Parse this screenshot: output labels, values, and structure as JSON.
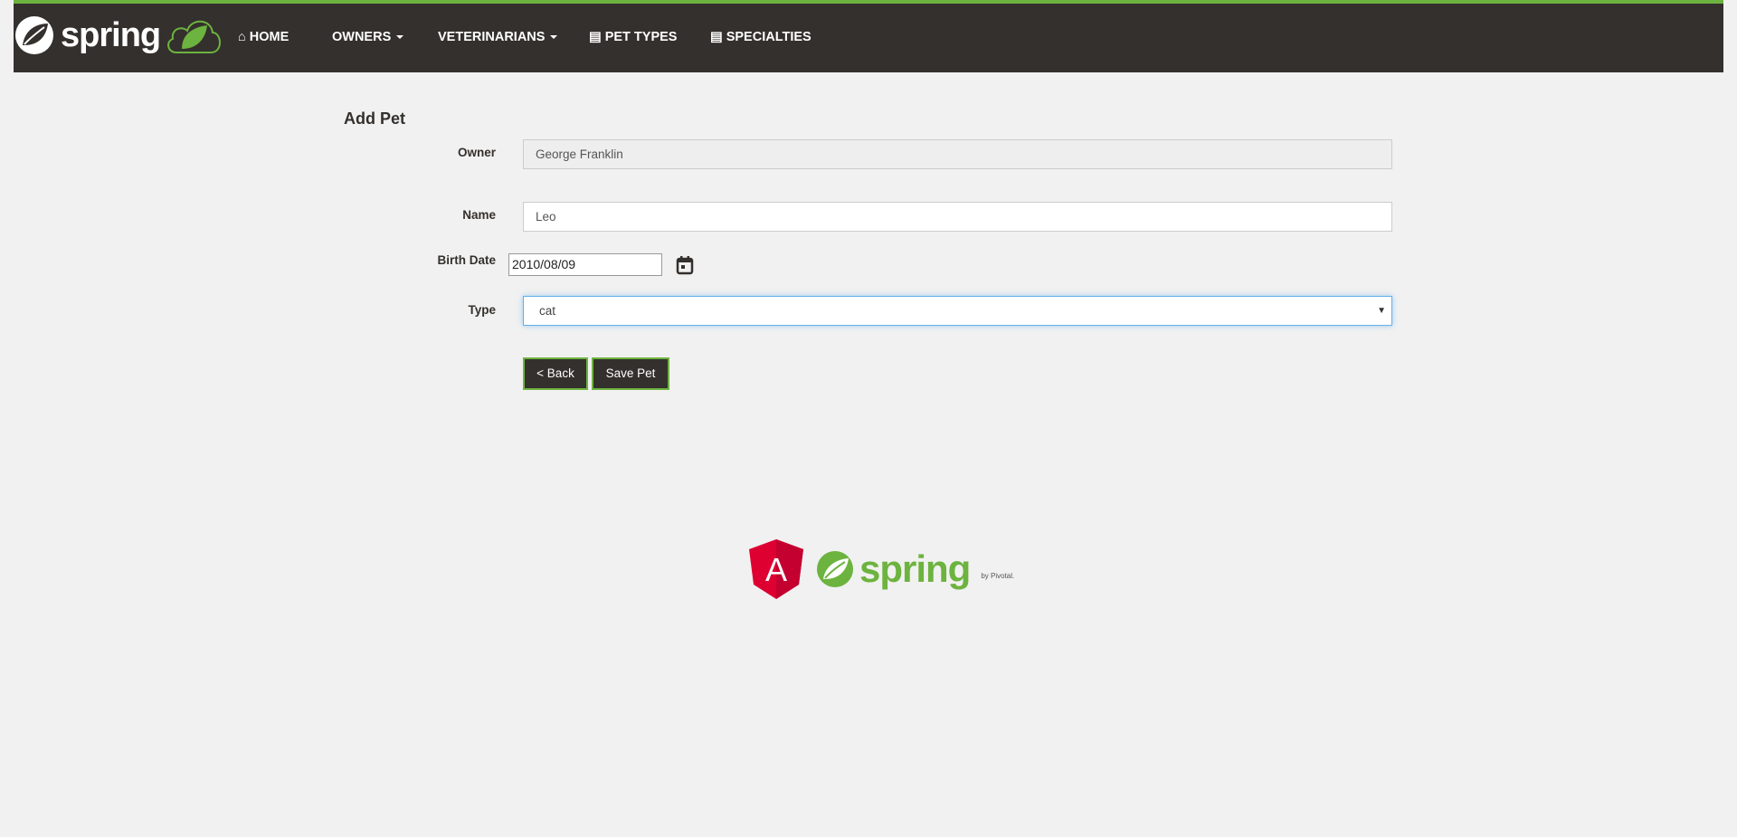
{
  "nav": {
    "brand": "spring",
    "items": [
      {
        "label": "HOME",
        "icon": "home-icon"
      },
      {
        "label": "OWNERS",
        "dropdown": true
      },
      {
        "label": "VETERINARIANS",
        "dropdown": true
      },
      {
        "label": "PET TYPES",
        "icon": "table-icon"
      },
      {
        "label": "SPECIALTIES",
        "icon": "table-icon"
      }
    ]
  },
  "form": {
    "title": "Add Pet",
    "owner_label": "Owner",
    "owner_value": "George Franklin",
    "name_label": "Name",
    "name_value": "Leo",
    "birth_label": "Birth Date",
    "birth_value": "2010/08/09",
    "type_label": "Type",
    "type_value": "cat",
    "back_label": "< Back",
    "save_label": "Save Pet"
  },
  "footer": {
    "angular_letter": "A",
    "spring": "spring",
    "by": "by Pivotal."
  },
  "colors": {
    "accent": "#6db33f",
    "dark": "#34302d",
    "angular": "#dd0031"
  }
}
